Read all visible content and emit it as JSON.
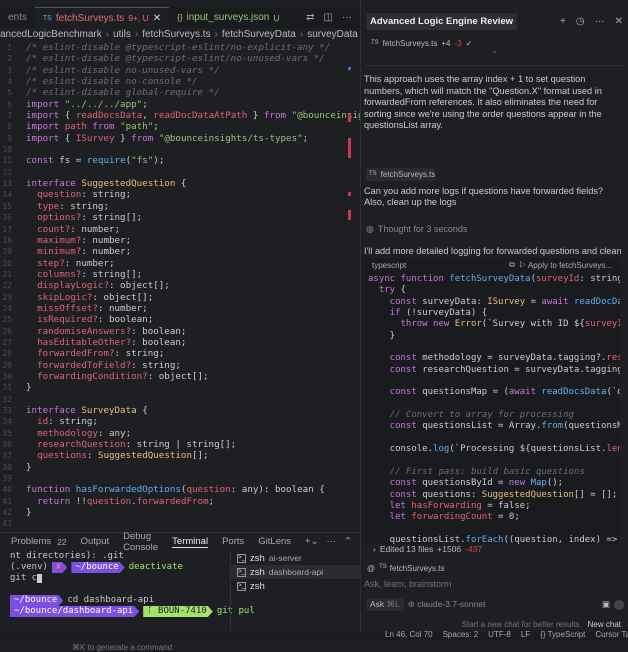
{
  "editor": {
    "tabs": [
      {
        "label": "ents"
      },
      {
        "label": "fetchSurveys.ts",
        "badge": "9+, U",
        "icon": "TS"
      },
      {
        "label": "input_surveys.json",
        "badge": "U",
        "icon": "{}"
      }
    ],
    "breadcrumb": [
      "ancedLogicBenchmark",
      "utils",
      "fetchSurveys.ts",
      "fetchSurveyData",
      "surveyData"
    ],
    "lines": [
      [
        [
          "/* eslint-disable @typescript-eslint/no-explicit-any */",
          "c"
        ]
      ],
      [
        [
          "/* eslint-disable @typescript-eslint/no-unused-vars */",
          "c"
        ]
      ],
      [
        [
          "/* eslint-disable no-unused-vars */",
          "c"
        ]
      ],
      [
        [
          "/* eslint-disable no-console */",
          "c"
        ]
      ],
      [
        [
          "/* eslint-disable global-require */",
          "c"
        ]
      ],
      [
        [
          "import ",
          "k"
        ],
        [
          "\"../../../app\"",
          "s"
        ],
        [
          ";",
          "d"
        ]
      ],
      [
        [
          "import ",
          "k"
        ],
        [
          "{ ",
          "d"
        ],
        [
          "readDocsData",
          "p"
        ],
        [
          ", ",
          "d"
        ],
        [
          "readDocDataAtPath",
          "p"
        ],
        [
          " } ",
          "d"
        ],
        [
          "from ",
          "k"
        ],
        [
          "\"@bounceinsights/api-",
          "s"
        ]
      ],
      [
        [
          "import ",
          "k"
        ],
        [
          "path ",
          "p"
        ],
        [
          "from ",
          "k"
        ],
        [
          "\"path\"",
          "s"
        ],
        [
          ";",
          "d"
        ]
      ],
      [
        [
          "import ",
          "k"
        ],
        [
          "{ ",
          "d"
        ],
        [
          "ISurvey",
          "p"
        ],
        [
          " } ",
          "d"
        ],
        [
          "from ",
          "k"
        ],
        [
          "\"@bounceinsights/ts-types\"",
          "s"
        ],
        [
          ";",
          "d"
        ]
      ],
      [],
      [
        [
          "const ",
          "k"
        ],
        [
          "fs = ",
          "d"
        ],
        [
          "require",
          "f"
        ],
        [
          "(",
          "d"
        ],
        [
          "\"fs\"",
          "s"
        ],
        [
          ");",
          "d"
        ]
      ],
      [],
      [
        [
          "interface ",
          "k"
        ],
        [
          "SuggestedQuestion",
          "t"
        ],
        [
          " {",
          "d"
        ]
      ],
      [
        [
          "  question",
          "p"
        ],
        [
          ": string;",
          "d"
        ]
      ],
      [
        [
          "  type",
          "p"
        ],
        [
          ": string;",
          "d"
        ]
      ],
      [
        [
          "  options?",
          "p"
        ],
        [
          ": string[];",
          "d"
        ]
      ],
      [
        [
          "  count?",
          "p"
        ],
        [
          ": number;",
          "d"
        ]
      ],
      [
        [
          "  maximum?",
          "p"
        ],
        [
          ": number;",
          "d"
        ]
      ],
      [
        [
          "  minimum?",
          "p"
        ],
        [
          ": number;",
          "d"
        ]
      ],
      [
        [
          "  step?",
          "p"
        ],
        [
          ": number;",
          "d"
        ]
      ],
      [
        [
          "  columns?",
          "p"
        ],
        [
          ": string[];",
          "d"
        ]
      ],
      [
        [
          "  displayLogic?",
          "p"
        ],
        [
          ": object[];",
          "d"
        ]
      ],
      [
        [
          "  skipLogic?",
          "p"
        ],
        [
          ": object[];",
          "d"
        ]
      ],
      [
        [
          "  missOffset?",
          "p"
        ],
        [
          ": number;",
          "d"
        ]
      ],
      [
        [
          "  isRequired?",
          "p"
        ],
        [
          ": boolean;",
          "d"
        ]
      ],
      [
        [
          "  randomiseAnswers?",
          "p"
        ],
        [
          ": boolean;",
          "d"
        ]
      ],
      [
        [
          "  hasEditableOther?",
          "p"
        ],
        [
          ": boolean;",
          "d"
        ]
      ],
      [
        [
          "  forwardedFrom?",
          "p"
        ],
        [
          ": string;",
          "d"
        ]
      ],
      [
        [
          "  forwardedToField?",
          "p"
        ],
        [
          ": string;",
          "d"
        ]
      ],
      [
        [
          "  forwardingCondition?",
          "p"
        ],
        [
          ": object[];",
          "d"
        ]
      ],
      [
        [
          "}",
          "d"
        ]
      ],
      [],
      [
        [
          "interface ",
          "k"
        ],
        [
          "SurveyData",
          "t"
        ],
        [
          " {",
          "d"
        ]
      ],
      [
        [
          "  id",
          "p"
        ],
        [
          ": string;",
          "d"
        ]
      ],
      [
        [
          "  methodology",
          "p"
        ],
        [
          ": any;",
          "d"
        ]
      ],
      [
        [
          "  researchQuestion",
          "p"
        ],
        [
          ": string | string[];",
          "d"
        ]
      ],
      [
        [
          "  questions",
          "p"
        ],
        [
          ": ",
          "d"
        ],
        [
          "SuggestedQuestion",
          "t"
        ],
        [
          "[];",
          "d"
        ]
      ],
      [
        [
          "}",
          "d"
        ]
      ],
      [],
      [
        [
          "function ",
          "k"
        ],
        [
          "hasForwardedOptions",
          "f"
        ],
        [
          "(",
          "d"
        ],
        [
          "question",
          "p"
        ],
        [
          ": any): boolean {",
          "d"
        ]
      ],
      [
        [
          "  return ",
          "k"
        ],
        [
          "!!",
          "d"
        ],
        [
          "question",
          "p"
        ],
        [
          ".",
          "d"
        ],
        [
          "forwardedFrom",
          "p"
        ],
        [
          ";",
          "d"
        ]
      ],
      [
        [
          "}",
          "d"
        ]
      ],
      []
    ]
  },
  "panel": {
    "tabs": [
      {
        "label": "Problems",
        "badge": "22"
      },
      {
        "label": "Output"
      },
      {
        "label": "Debug Console"
      },
      {
        "label": "Terminal"
      },
      {
        "label": "Ports"
      },
      {
        "label": "GitLens"
      }
    ],
    "terminal": {
      "line1": "nt directories): .git",
      "venv": "(.venv)",
      "x": "✘",
      "dir1": "~/bounce",
      "cmd1": "deactivate",
      "line3": "git c",
      "dir2": "~/bounce",
      "cmd2": "cd dashboard-api",
      "dir3": "~/bounce/dashboard-api",
      "branch": "ᚴ BOUN-7410",
      "cmd3": "git pul",
      "hint": "⌘K to generate a command"
    },
    "terminals": [
      {
        "name": "zsh",
        "sub": "ai-server"
      },
      {
        "name": "zsh",
        "sub": "dashboard-api"
      },
      {
        "name": "zsh",
        "sub": ""
      }
    ]
  },
  "chat": {
    "title": "Advanced Logic Engine Review",
    "file_chip": {
      "name": "fetchSurveys.ts",
      "added": "+4",
      "removed": "-3"
    },
    "message1": "This approach uses the array index + 1 to set question numbers, which will match the \"Question.X\" format used in forwardedFrom references. It also eliminates the need for sorting since we're using the order questions appear in the questionsList array.",
    "user_file": "fetchSurveys.ts",
    "user_message": "Can you add more logs if questions have forwarded fields? Also, clean up the logs",
    "thought": "Thought for 3 seconds",
    "reply": "I'll add more detailed logging for forwarded questions and clean up the existing logs:",
    "codeblock": {
      "lang": "typescript",
      "apply": "Apply to fetchSurveys...",
      "lines": [
        [
          [
            "async ",
            "k"
          ],
          [
            "function ",
            "k"
          ],
          [
            "fetchSurveyData",
            "f"
          ],
          [
            "(",
            "d"
          ],
          [
            "surveyId",
            "p"
          ],
          [
            ": string): Promi",
            "d"
          ]
        ],
        [
          [
            "  try ",
            "k"
          ],
          [
            "{",
            "d"
          ]
        ],
        [
          [
            "    const ",
            "k"
          ],
          [
            "surveyData: ",
            "d"
          ],
          [
            "ISurvey",
            "t"
          ],
          [
            " = ",
            "d"
          ],
          [
            "await ",
            "k"
          ],
          [
            "readDocDataAtPath",
            "f"
          ]
        ],
        [
          [
            "    if ",
            "k"
          ],
          [
            "(!surveyData) {",
            "d"
          ]
        ],
        [
          [
            "      throw new ",
            "k"
          ],
          [
            "Error",
            "t"
          ],
          [
            "(`Survey with ID ${",
            "d"
          ],
          [
            "surveyId",
            "p"
          ],
          [
            "} not f",
            "d"
          ]
        ],
        [
          [
            "    }",
            "d"
          ]
        ],
        [],
        [
          [
            "    const ",
            "k"
          ],
          [
            "methodology = surveyData.tagging?.",
            "d"
          ],
          [
            "researchMet",
            "p"
          ]
        ],
        [
          [
            "    const ",
            "k"
          ],
          [
            "researchQuestion = surveyData.tagging?.",
            "d"
          ],
          [
            "resear",
            "p"
          ]
        ],
        [],
        [
          [
            "    const ",
            "k"
          ],
          [
            "questionsMap = (",
            "d"
          ],
          [
            "await ",
            "k"
          ],
          [
            "readDocsData",
            "f"
          ],
          [
            "(`draftSurv",
            "d"
          ]
        ],
        [],
        [
          [
            "    // Convert to array for processing",
            "c"
          ]
        ],
        [
          [
            "    const ",
            "k"
          ],
          [
            "questionsList = Array.",
            "d"
          ],
          [
            "from",
            "f"
          ],
          [
            "(questionsMap.entri",
            "d"
          ]
        ],
        [],
        [
          [
            "    console.",
            "d"
          ],
          [
            "log",
            "f"
          ],
          [
            "(`Processing ${questionsList.",
            "d"
          ],
          [
            "length",
            "p"
          ],
          [
            "} que",
            "d"
          ]
        ],
        [],
        [
          [
            "    // First pass: build basic questions",
            "c"
          ]
        ],
        [
          [
            "    const ",
            "k"
          ],
          [
            "questionsById = ",
            "d"
          ],
          [
            "new ",
            "k"
          ],
          [
            "Map",
            "f"
          ],
          [
            "();",
            "d"
          ]
        ],
        [
          [
            "    const ",
            "k"
          ],
          [
            "questions: ",
            "d"
          ],
          [
            "SuggestedQuestion",
            "t"
          ],
          [
            "[] = [];",
            "d"
          ]
        ],
        [
          [
            "    let ",
            "k"
          ],
          [
            "hasForwarding",
            "p"
          ],
          [
            " = false;",
            "d"
          ]
        ],
        [
          [
            "    let ",
            "k"
          ],
          [
            "forwardingCount",
            "p"
          ],
          [
            " = 0;",
            "d"
          ]
        ],
        [],
        [
          [
            "    questionsList.",
            "d"
          ],
          [
            "forEach",
            "f"
          ],
          [
            "((question, index) => {",
            "d"
          ]
        ]
      ]
    },
    "edited_summary": "Edited 13 files",
    "edited_added": "+1506",
    "edited_removed": "-437",
    "input_file": "fetchSurveys.ts",
    "input_placeholder": "Ask, learn, brainstorm",
    "mode": "Ask",
    "mode_shortcut": "⌘L",
    "model": "claude-3.7-sonnet",
    "new_chat_hint": "Start a new chat for better results.",
    "new_chat": "New chat"
  },
  "status": [
    "Ln 46, Col 70",
    "Spaces: 2",
    "UTF-8",
    "LF",
    "{} TypeScript",
    "Cursor Tab"
  ]
}
